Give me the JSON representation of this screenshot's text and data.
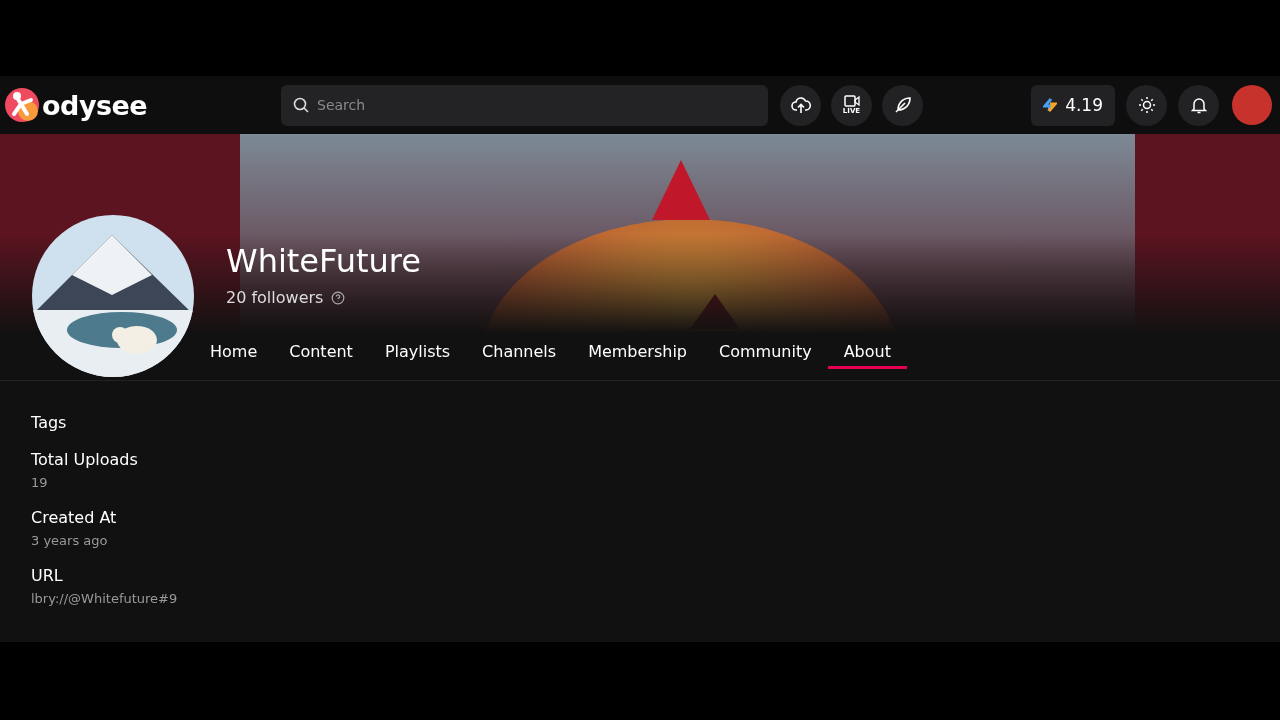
{
  "header": {
    "logo": "odysee",
    "search": {
      "placeholder": "Search"
    },
    "live_label": "LIVE",
    "credits": "4.19"
  },
  "channel": {
    "name": "WhiteFuture",
    "followers": "20 followers"
  },
  "tabs": [
    {
      "label": "Home",
      "selected": false
    },
    {
      "label": "Content",
      "selected": false
    },
    {
      "label": "Playlists",
      "selected": false
    },
    {
      "label": "Channels",
      "selected": false
    },
    {
      "label": "Membership",
      "selected": false
    },
    {
      "label": "Community",
      "selected": false
    },
    {
      "label": "About",
      "selected": true
    }
  ],
  "about": [
    {
      "label": "Tags"
    },
    {
      "label": "Total Uploads",
      "value": "19"
    },
    {
      "label": "Created At",
      "value": "3 years ago"
    },
    {
      "label": "URL",
      "value": "lbry://@Whitefuture#9"
    }
  ]
}
